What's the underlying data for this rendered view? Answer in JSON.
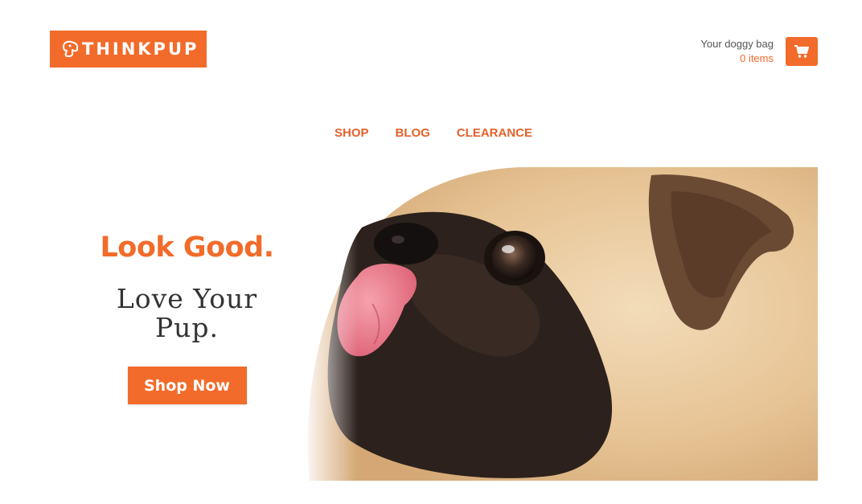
{
  "brand": {
    "name": "THINKPUP",
    "logo_icon": "dog-head-icon",
    "accent_color": "#f26b2a"
  },
  "cart": {
    "title": "Your doggy bag",
    "count_text": "0 items",
    "icon": "shopping-cart-icon"
  },
  "nav": {
    "items": [
      {
        "label": "SHOP"
      },
      {
        "label": "BLOG"
      },
      {
        "label": "CLEARANCE"
      }
    ]
  },
  "hero": {
    "headline": "Look Good.",
    "subline": "Love Your Pup.",
    "cta_label": "Shop Now",
    "image": "pug-licking-nose-photo"
  }
}
